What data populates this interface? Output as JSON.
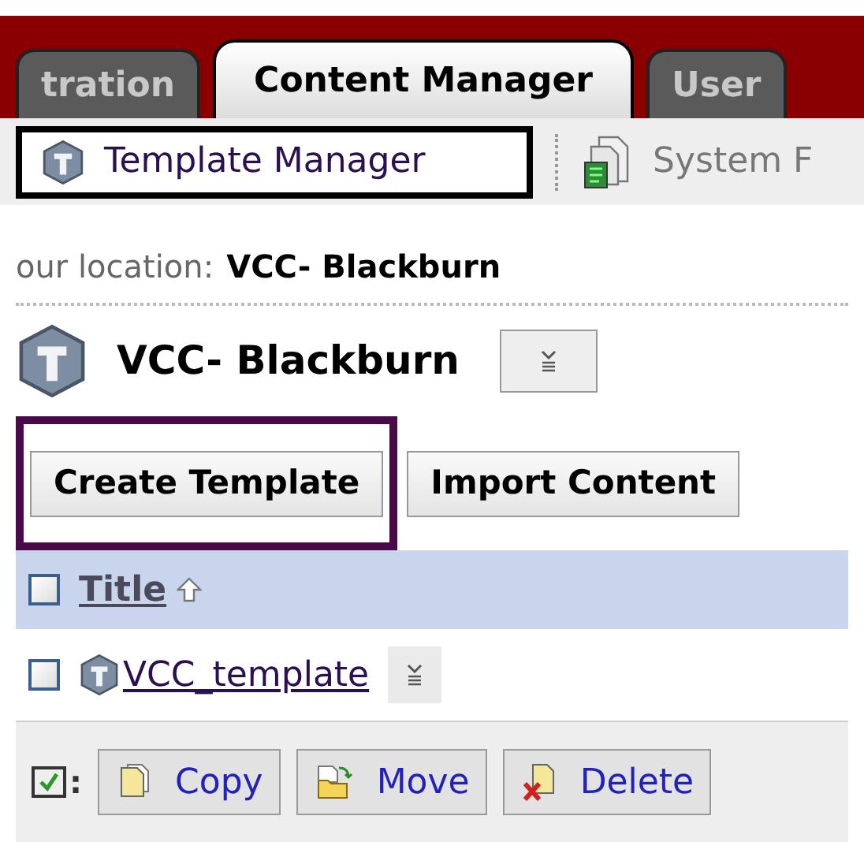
{
  "tabs": [
    {
      "label": "tration",
      "selected": false
    },
    {
      "label": "Content Manager",
      "selected": true
    },
    {
      "label": "User",
      "selected": false
    }
  ],
  "subnav": [
    {
      "label": "Template Manager",
      "selected": true,
      "kind": "template"
    },
    {
      "label": "System F",
      "selected": false,
      "kind": "system"
    }
  ],
  "location": {
    "label": "our location:",
    "value": "VCC- Blackburn"
  },
  "heading": "VCC- Blackburn",
  "actions": [
    {
      "label": "Create Template",
      "highlighted": true
    },
    {
      "label": "Import Content",
      "highlighted": false
    }
  ],
  "table": {
    "select_all_checked": false,
    "column": "Title",
    "rows": [
      {
        "name": "VCC_template",
        "checked": false
      }
    ]
  },
  "bulk": {
    "checked": true,
    "separator": ":",
    "buttons": [
      {
        "kind": "copy",
        "label": "Copy"
      },
      {
        "kind": "move",
        "label": "Move"
      },
      {
        "kind": "delete",
        "label": "Delete"
      }
    ]
  }
}
